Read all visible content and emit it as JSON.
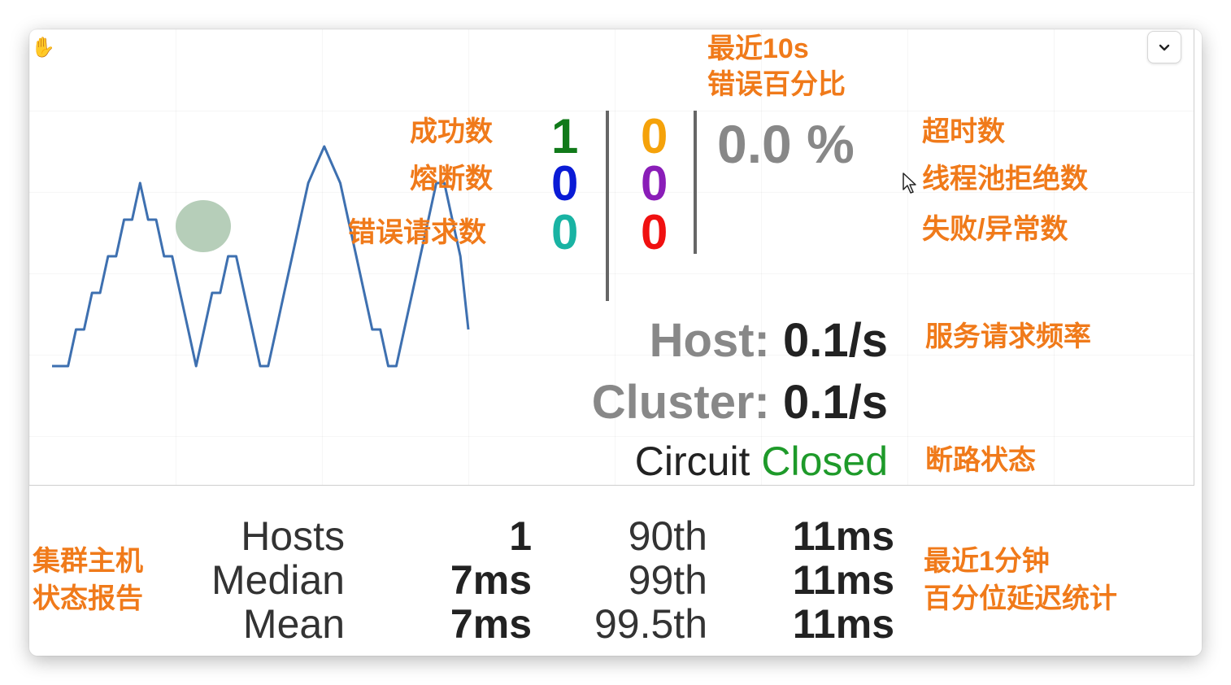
{
  "icons": {
    "hand": "hand-cursor-icon",
    "expand": "chevron-down-icon",
    "pointer": "arrow-cursor-icon"
  },
  "annotations": {
    "error_pct_line1": "最近10s",
    "error_pct_line2": "错误百分比",
    "success": "成功数",
    "short_circuited": "熔断数",
    "bad_request": "错误请求数",
    "timeout": "超时数",
    "rejected": "线程池拒绝数",
    "failure": "失败/异常数",
    "request_rate": "服务请求频率",
    "circuit_state": "断路状态",
    "hosts_line1": "集群主机",
    "hosts_line2": "状态报告",
    "latency_line1": "最近1分钟",
    "latency_line2": "百分位延迟统计"
  },
  "counters": {
    "success": "1",
    "short_circuited": "0",
    "bad_request": "0",
    "timeout": "0",
    "rejected": "0",
    "failure": "0",
    "error_percentage": "0.0 %"
  },
  "colors": {
    "annotation": "#f07a1a",
    "success": "#117a1a",
    "short_circuited": "#0a1bd6",
    "bad_request": "#19b3a3",
    "timeout": "#f5a20a",
    "rejected": "#8a1db8",
    "failure": "#f01010",
    "closed": "#1e9a2a",
    "sparkline": "#3e70b0",
    "circle": "#a9c5ad"
  },
  "rates": {
    "host_label": "Host:",
    "host_value": "0.1/s",
    "cluster_label": "Cluster:",
    "cluster_value": "0.1/s"
  },
  "circuit": {
    "label": "Circuit",
    "status": "Closed"
  },
  "stats": {
    "labels_left": [
      "Hosts",
      "Median",
      "Mean"
    ],
    "values_left": [
      "1",
      "7ms",
      "7ms"
    ],
    "labels_right": [
      "90th",
      "99th",
      "99.5th"
    ],
    "values_right": [
      "11ms",
      "11ms",
      "11ms"
    ]
  },
  "sparkline": {
    "values": [
      0,
      0,
      0,
      2,
      2,
      4,
      4,
      6,
      6,
      8,
      8,
      10,
      8,
      8,
      6,
      6,
      4,
      2,
      0,
      2,
      4,
      4,
      6,
      6,
      4,
      2,
      0,
      0,
      2,
      4,
      6,
      8,
      10,
      11,
      12,
      11,
      10,
      8,
      6,
      4,
      2,
      2,
      0,
      0,
      2,
      4,
      6,
      8,
      10,
      10,
      8,
      6,
      2
    ]
  },
  "health_circle": {
    "size": "small",
    "status": "healthy"
  }
}
